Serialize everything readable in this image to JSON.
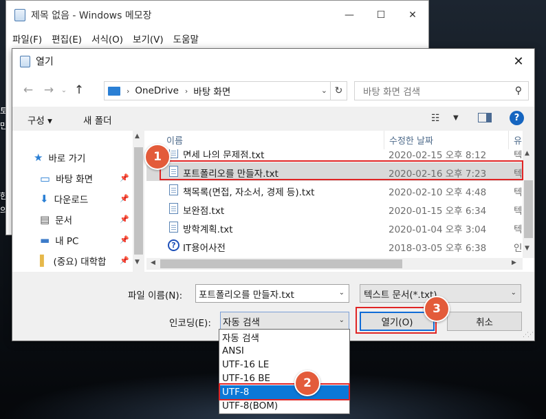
{
  "notepad": {
    "title": "제목 없음 - Windows 메모장",
    "menus": [
      "파일(F)",
      "편집(E)",
      "서식(O)",
      "보기(V)",
      "도움말"
    ],
    "minimize_glyph": "—",
    "maximize_glyph": "☐",
    "close_glyph": "✕"
  },
  "desktop_fragments": [
    "토",
    "만",
    "한",
    "의"
  ],
  "dialog": {
    "title": "열기",
    "close_glyph": "✕",
    "nav": {
      "back": "←",
      "forward": "→",
      "up": "↑"
    },
    "address": {
      "chevron": "›",
      "segments": [
        "OneDrive",
        "바탕 화면"
      ],
      "dropdown": "⌄",
      "refresh": "↻"
    },
    "search": {
      "placeholder": "바탕 화면 검색",
      "icon": "⚲"
    },
    "toolbar": {
      "organize": "구성 ▾",
      "new_folder": "새 폴더",
      "view_icon": "☷",
      "view_dropdown": "▼",
      "help": "?"
    },
    "nav_pane": {
      "items": [
        {
          "label": "바로 가기",
          "icon": "star-icon",
          "glyph": "★",
          "color": "#2a7fd4"
        },
        {
          "label": "바탕 화면",
          "icon": "desktop-icon",
          "glyph": "▭",
          "color": "#2a7fd4",
          "pinned": true
        },
        {
          "label": "다운로드",
          "icon": "download-icon",
          "glyph": "⬇",
          "color": "#2a7fd4",
          "pinned": true
        },
        {
          "label": "문서",
          "icon": "document-icon",
          "glyph": "▤",
          "color": "#555555",
          "pinned": true
        },
        {
          "label": "내 PC",
          "icon": "computer-icon",
          "glyph": "▬",
          "color": "#3d7cc9",
          "pinned": true
        },
        {
          "label": "(중요) 대학합",
          "icon": "folder-icon",
          "glyph": "▌",
          "color": "#e6b84a",
          "pinned": true
        }
      ],
      "pin_glyph": "📌"
    },
    "columns": {
      "name": "이름",
      "date": "수정한 날짜",
      "type": "유"
    },
    "files": [
      {
        "name": "면세 나의 문제점.txt",
        "date": "2020-02-15 오후 8:12",
        "type": "텍",
        "partial": true
      },
      {
        "name": "포트폴리오를 만들자.txt",
        "date": "2020-02-16 오후 7:23",
        "type": "텍",
        "selected": true
      },
      {
        "name": "책목록(면접, 자소서, 경제 등).txt",
        "date": "2020-02-10 오후 4:48",
        "type": "텍"
      },
      {
        "name": "보완점.txt",
        "date": "2020-01-15 오후 6:34",
        "type": "텍"
      },
      {
        "name": "방학계획.txt",
        "date": "2020-01-04 오후 3:04",
        "type": "텍"
      },
      {
        "name": "IT용어사전",
        "date": "2018-03-05 오후 6:38",
        "type": "인",
        "shortcut": true
      }
    ],
    "form": {
      "filename_label": "파일 이름(N):",
      "filename_value": "포트폴리오를 만들자.txt",
      "filetype_value": "텍스트 문서(*.txt)",
      "encoding_label": "인코딩(E):",
      "encoding_value": "자동 검색",
      "open_button": "열기(O)",
      "cancel_button": "취소",
      "combo_arrow": "⌄"
    }
  },
  "encoding_dropdown": {
    "options": [
      "자동 검색",
      "ANSI",
      "UTF-16 LE",
      "UTF-16 BE",
      "UTF-8",
      "UTF-8(BOM)"
    ],
    "selected_index": 4
  },
  "markers": [
    "1",
    "2",
    "3"
  ],
  "colors": {
    "highlight_red": "#e02424",
    "marker_orange": "#e35b3a",
    "selection_blue": "#0b78d7"
  }
}
